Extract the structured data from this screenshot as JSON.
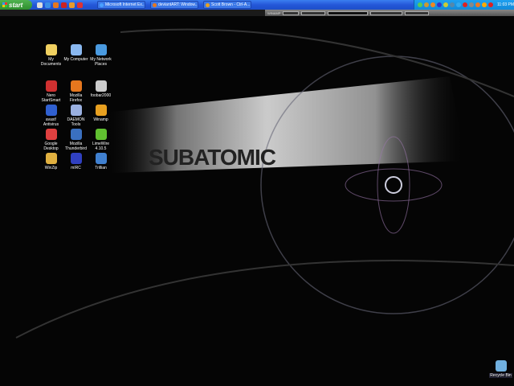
{
  "taskbar": {
    "start_label": "start",
    "quick_launch": [
      {
        "icon": "show-desktop-icon",
        "color": "#dddddd"
      },
      {
        "icon": "ie-icon",
        "color": "#3a8ee6"
      },
      {
        "icon": "firefox-icon",
        "color": "#e6771e"
      },
      {
        "icon": "winrar-icon",
        "color": "#c22"
      },
      {
        "icon": "app-icon",
        "color": "#e89a2a"
      },
      {
        "icon": "nero-icon",
        "color": "#d33"
      }
    ],
    "tasks": [
      {
        "label": "Microsoft Internet Ex...",
        "color": "#4aa0ff"
      },
      {
        "label": "deviantART: Window...",
        "color": "#e6771e"
      },
      {
        "label": "Scott Brown - Ctrl-A...",
        "color": "#e8a020"
      }
    ],
    "tray_icons": [
      "#5c5",
      "#c93",
      "#e82",
      "#33c",
      "#cc3",
      "#58a",
      "#3ae",
      "#d22",
      "#888",
      "#e72",
      "#fa0",
      "#d22"
    ],
    "clock": "11:03 PM"
  },
  "winamp_bar": {
    "label": "WINAMP"
  },
  "desktop_icons": [
    {
      "label": "My Documents",
      "icon": "my-documents-icon",
      "color": "#f0d060"
    },
    {
      "label": "My Computer",
      "icon": "my-computer-icon",
      "color": "#8ab8f0"
    },
    {
      "label": "My Network Places",
      "icon": "network-places-icon",
      "color": "#4a9ae0"
    },
    {
      "label": "Nero StartSmart",
      "icon": "nero-icon",
      "color": "#d03030"
    },
    {
      "label": "Mozilla Firefox",
      "icon": "firefox-icon",
      "color": "#e6771e"
    },
    {
      "label": "foobar2000",
      "icon": "foobar-icon",
      "color": "#cccccc"
    },
    {
      "label": "avast! Antivirus",
      "icon": "avast-icon",
      "color": "#3060d0"
    },
    {
      "label": "DAEMON Tools",
      "icon": "daemon-tools-icon",
      "color": "#9ab0e0"
    },
    {
      "label": "Winamp",
      "icon": "winamp-icon",
      "color": "#e8a020"
    },
    {
      "label": "Google Desktop",
      "icon": "google-desktop-icon",
      "color": "#e04040"
    },
    {
      "label": "Mozilla Thunderbird",
      "icon": "thunderbird-icon",
      "color": "#3a70c0"
    },
    {
      "label": "LimeWire 4.10.5",
      "icon": "limewire-icon",
      "color": "#60c030"
    },
    {
      "label": "WinZip",
      "icon": "winzip-icon",
      "color": "#e0b040"
    },
    {
      "label": "mIRC",
      "icon": "mirc-icon",
      "color": "#3040c0"
    },
    {
      "label": "Trillian",
      "icon": "trillian-icon",
      "color": "#4080d0"
    }
  ],
  "recycle_bin": {
    "label": "Recycle Bin",
    "icon": "recycle-bin-icon",
    "color": "#70b0e0"
  },
  "wallpaper": {
    "text": "SUBATOMIC"
  }
}
